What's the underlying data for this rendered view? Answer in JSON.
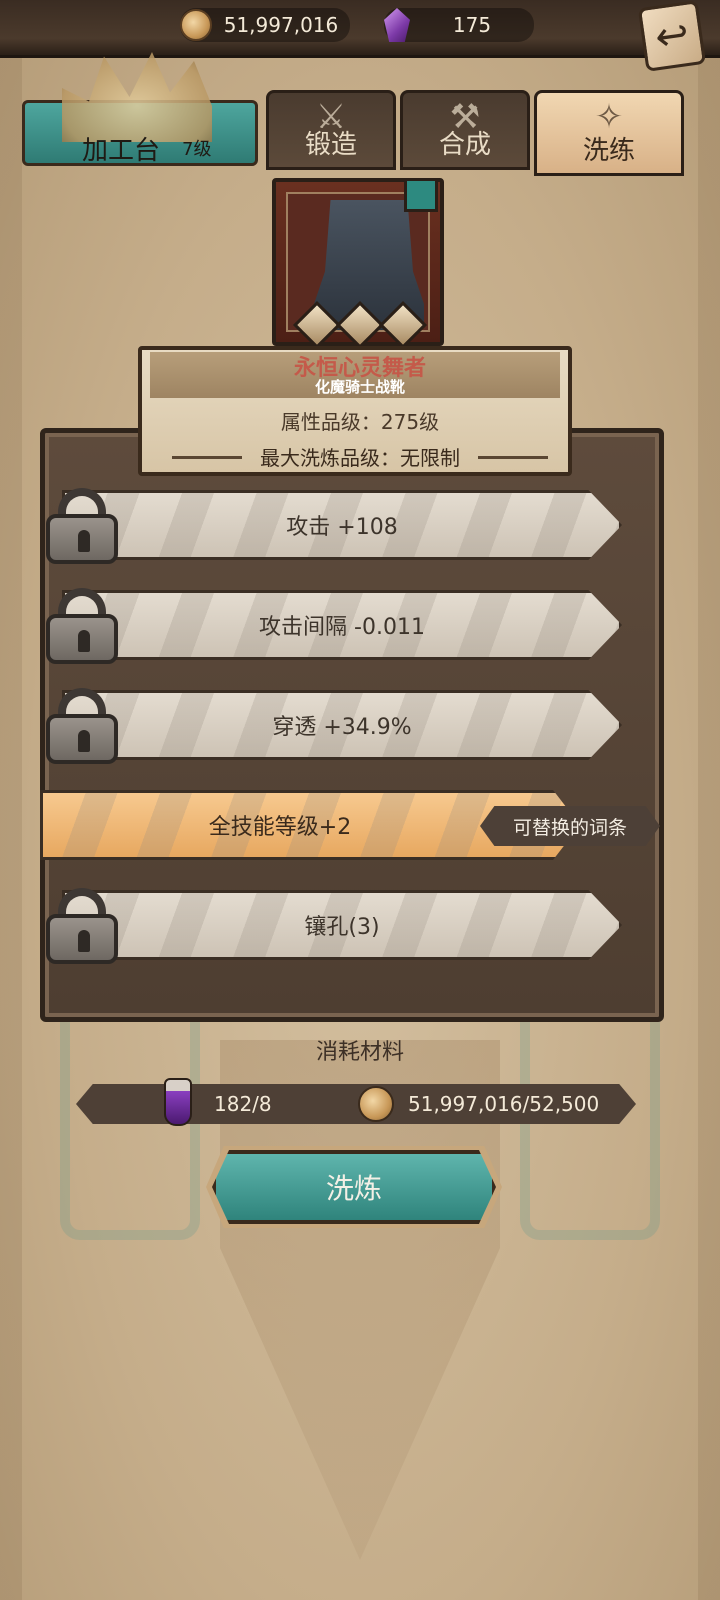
{
  "resources": {
    "gold": "51,997,016",
    "gems": "175"
  },
  "workbench": {
    "label": "加工台",
    "level": "7级"
  },
  "tabs": {
    "forge": "锻造",
    "craft": "合成",
    "reforge": "洗练"
  },
  "item": {
    "name": "永恒心灵舞者",
    "subtitle": "化魔骑士战靴",
    "attr_level": "属性品级：275级",
    "max_reforge": "最大洗炼品级：无限制"
  },
  "stats": [
    {
      "text": "攻击 +108",
      "locked": true
    },
    {
      "text": "攻击间隔 -0.011",
      "locked": true
    },
    {
      "text": "穿透 +34.9%",
      "locked": true
    },
    {
      "text": "全技能等级+2",
      "locked": false
    },
    {
      "text": "镶孔(3)",
      "locked": true
    }
  ],
  "replace_tag": "可替换的词条",
  "materials": {
    "title": "消耗材料",
    "potion_count": "182/8",
    "gold_count": "51,997,016/52,500"
  },
  "reforge_button": "洗炼"
}
